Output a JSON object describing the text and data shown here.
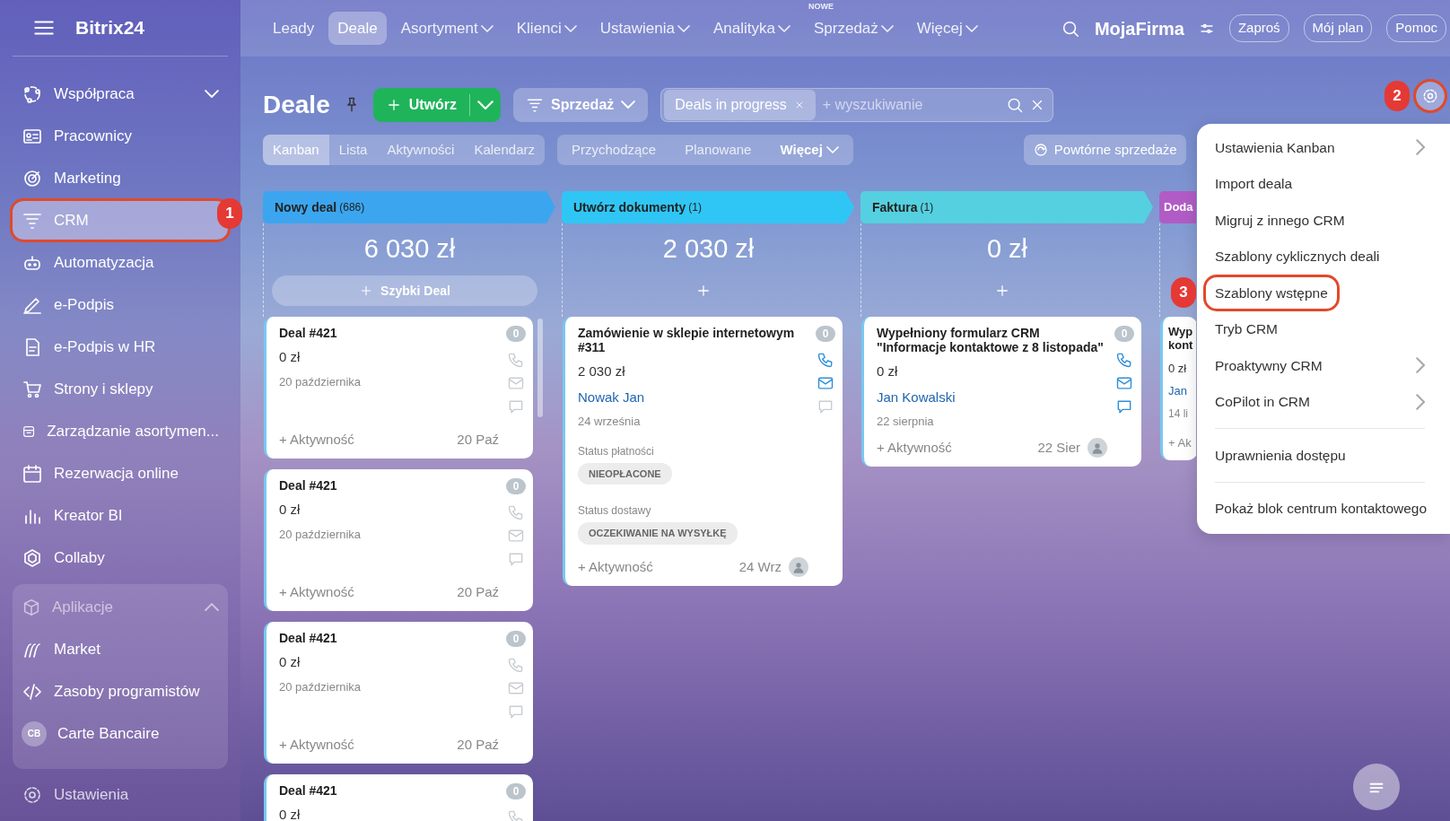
{
  "sidebar": {
    "logo": "Bitrix24",
    "items": [
      {
        "label": "Współpraca",
        "selected": false,
        "expanded": false
      },
      {
        "label": "Pracownicy",
        "selected": false
      },
      {
        "label": "Marketing",
        "selected": false
      },
      {
        "label": "CRM",
        "selected": true,
        "callout": "1"
      },
      {
        "label": "Automatyzacja",
        "selected": false
      },
      {
        "label": "e-Podpis",
        "selected": false
      },
      {
        "label": "e-Podpis w HR",
        "selected": false
      },
      {
        "label": "Strony i sklepy",
        "selected": false
      },
      {
        "label": "Zarządzanie asortymen...",
        "selected": false
      },
      {
        "label": "Rezerwacja online",
        "selected": false
      },
      {
        "label": "Kreator BI",
        "selected": false
      },
      {
        "label": "Collaby",
        "selected": false
      }
    ],
    "apps": {
      "label": "Aplikacje",
      "expanded": true,
      "items": [
        {
          "kind": "icon",
          "label": "Market",
          "selected": false
        },
        {
          "kind": "icon",
          "label": "Zasoby programistów",
          "selected": false
        },
        {
          "kind": "avatar",
          "initials": "CB",
          "label": "Carte Bancaire",
          "selected": false
        }
      ]
    },
    "settings": "Ustawienia"
  },
  "top_nav": {
    "items": [
      {
        "label": "Leady",
        "selected": false,
        "dropdown": false
      },
      {
        "label": "Deale",
        "selected": true,
        "dropdown": false
      },
      {
        "label": "Asortyment",
        "selected": false,
        "dropdown": true
      },
      {
        "label": "Klienci",
        "selected": false,
        "dropdown": true
      },
      {
        "label": "Ustawienia",
        "selected": false,
        "dropdown": true
      },
      {
        "label": "Analityka",
        "selected": false,
        "dropdown": true
      },
      {
        "label": "Sprzedaż",
        "selected": false,
        "dropdown": true,
        "badge": "NOWE"
      },
      {
        "label": "Więcej",
        "selected": false,
        "dropdown": true
      }
    ],
    "company": "MojaFirma",
    "buttons": [
      "Zaproś",
      "Mój plan",
      "Pomoc"
    ]
  },
  "toolbar": {
    "title": "Deale",
    "create": "Utwórz",
    "pipeline": "Sprzedaż",
    "filter_chips": [
      "Deals in progress"
    ],
    "search": {
      "placeholder": "+ wyszukiwanie"
    },
    "settings_callout": "2"
  },
  "views": {
    "tabs": [
      {
        "label": "Kanban",
        "selected": true
      },
      {
        "label": "Lista",
        "selected": false
      },
      {
        "label": "Aktywności",
        "selected": false
      },
      {
        "label": "Kalendarz",
        "selected": false
      }
    ],
    "filters": [
      {
        "label": "Przychodzące",
        "dropdown": false
      },
      {
        "label": "Planowane",
        "dropdown": false
      },
      {
        "label": "Więcej",
        "dropdown": true
      }
    ],
    "repeat_sales": "Powtórne sprzedaże"
  },
  "columns": [
    {
      "title": "Nowy deal",
      "count": "(686)",
      "color": "#3ba6ef",
      "total": "6 030 zł",
      "quick_add": "Szybki Deal",
      "cards": [
        {
          "title": "Deal #421",
          "counter": "0",
          "amount": "0 zł",
          "date": "20 października",
          "activity": "+ Aktywność",
          "due": "20 Paź",
          "call_active": false,
          "mail_active": false,
          "chat_active": false
        },
        {
          "title": "Deal #421",
          "counter": "0",
          "amount": "0 zł",
          "date": "20 października",
          "activity": "+ Aktywność",
          "due": "20 Paź",
          "call_active": false,
          "mail_active": false,
          "chat_active": false
        },
        {
          "title": "Deal #421",
          "counter": "0",
          "amount": "0 zł",
          "date": "20 października",
          "activity": "+ Aktywność",
          "due": "20 Paź",
          "call_active": false,
          "mail_active": false,
          "chat_active": false
        },
        {
          "title": "Deal #421",
          "counter": "0",
          "amount": "0 zł",
          "call_active": false
        }
      ]
    },
    {
      "title": "Utwórz dokumenty",
      "count": "(1)",
      "color": "#2fc6f6",
      "total": "2 030 zł",
      "cards": [
        {
          "title": "Zamówienie w sklepie internetowym #311",
          "counter": "0",
          "amount": "2 030 zł",
          "contact": "Nowak Jan",
          "date": "24 września",
          "fields": [
            {
              "label": "Status płatności",
              "value": "NIEOPŁACONE"
            },
            {
              "label": "Status dostawy",
              "value": "OCZEKIWANIE NA WYSYŁKĘ"
            }
          ],
          "activity": "+ Aktywność",
          "due": "24 Wrz",
          "avatar": true,
          "call_active": true,
          "mail_active": true,
          "chat_active": false
        }
      ]
    },
    {
      "title": "Faktura",
      "count": "(1)",
      "color": "#55d0e0",
      "total": "0 zł",
      "cards": [
        {
          "title": "Wypełniony formularz CRM \"Informacje kontaktowe z 8 listopada\"",
          "counter": "0",
          "amount": "0 zł",
          "contact": "Jan Kowalski",
          "date": "22 sierpnia",
          "activity": "+ Aktywność",
          "due": "22 Sier",
          "avatar": true,
          "call_active": true,
          "mail_active": true,
          "chat_active": true
        }
      ]
    },
    {
      "title": "Doda",
      "color": "#b15cc6",
      "cards": [
        {
          "title": "Wyp kont",
          "amount": "0 zł",
          "contact": "Jan",
          "date": "14 li",
          "activity": "+ Ak"
        }
      ]
    }
  ],
  "menu": {
    "sections": [
      [
        {
          "label": "Ustawienia Kanban",
          "submenu": true
        },
        {
          "label": "Import deala",
          "submenu": false
        },
        {
          "label": "Migruj z innego CRM",
          "submenu": false
        },
        {
          "label": "Szablony cyklicznych deali",
          "submenu": false
        },
        {
          "label": "Szablony wstępne",
          "submenu": false,
          "callout": "3"
        },
        {
          "label": "Tryb CRM",
          "submenu": false
        },
        {
          "label": "Proaktywny CRM",
          "submenu": true
        },
        {
          "label": "CoPilot in CRM",
          "submenu": true
        }
      ],
      [
        {
          "label": "Uprawnienia dostępu",
          "submenu": false
        }
      ],
      [
        {
          "label": "Pokaż blok centrum kontaktowego",
          "submenu": false
        }
      ]
    ]
  }
}
